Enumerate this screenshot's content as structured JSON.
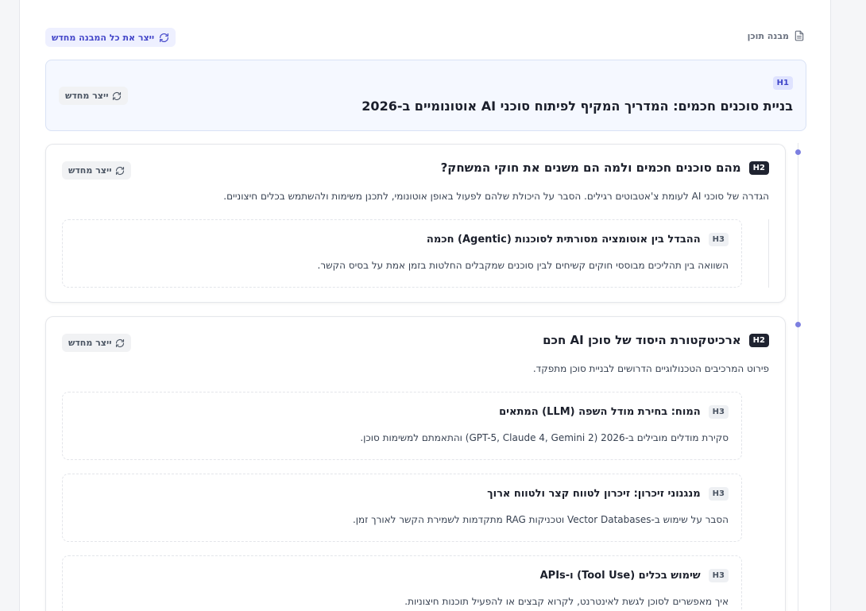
{
  "toolbar": {
    "regenerate_all_label": "ייצר את כל המבנה מחדש",
    "section_title": "מבנה תוכן"
  },
  "regenerate_label": "ייצר מחדש",
  "h1": {
    "badge": "H1",
    "title": "בניית סוכנים חכמים: המדריך המקיף לפיתוח סוכני AI אוטונומיים ב-2026"
  },
  "sections": [
    {
      "badge": "H2",
      "title": "מהם סוכנים חכמים ולמה הם משנים את חוקי המשחק?",
      "description": "הגדרה של סוכני AI לעומת צ'אטבוטים רגילים. הסבר על היכולת שלהם לפעול באופן אוטונומי, לתכנן משימות ולהשתמש בכלים חיצוניים.",
      "subsections": [
        {
          "badge": "H3",
          "title": "ההבדל בין אוטומציה מסורתית לסוכנות (Agentic) חכמה",
          "description": "השוואה בין תהליכים מבוססי חוקים קשיחים לבין סוכנים שמקבלים החלטות בזמן אמת על בסיס הקשר."
        }
      ]
    },
    {
      "badge": "H2",
      "title": "ארכיטקטורת היסוד של סוכן AI חכם",
      "description": "פירוט המרכיבים הטכנולוגיים הדרושים לבניית סוכן מתפקד.",
      "subsections": [
        {
          "badge": "H3",
          "title": "המוח: בחירת מודל השפה (LLM) המתאים",
          "description": "סקירת מודלים מובילים ב-2026 (GPT-5, Claude 4, Gemini 2) והתאמתם למשימות סוכן."
        },
        {
          "badge": "H3",
          "title": "מנגנוני זיכרון: זיכרון לטווח קצר ולטווח ארוך",
          "description": "הסבר על שימוש ב-Vector Databases וטכניקות RAG מתקדמות לשמירת הקשר לאורך זמן."
        },
        {
          "badge": "H3",
          "title": "שימוש בכלים (Tool Use) ו-APIs",
          "description": "איך מאפשרים לסוכן לגשת לאינטרנט, לקרוא קבצים או להפעיל תוכנות חיצוניות."
        }
      ]
    }
  ]
}
